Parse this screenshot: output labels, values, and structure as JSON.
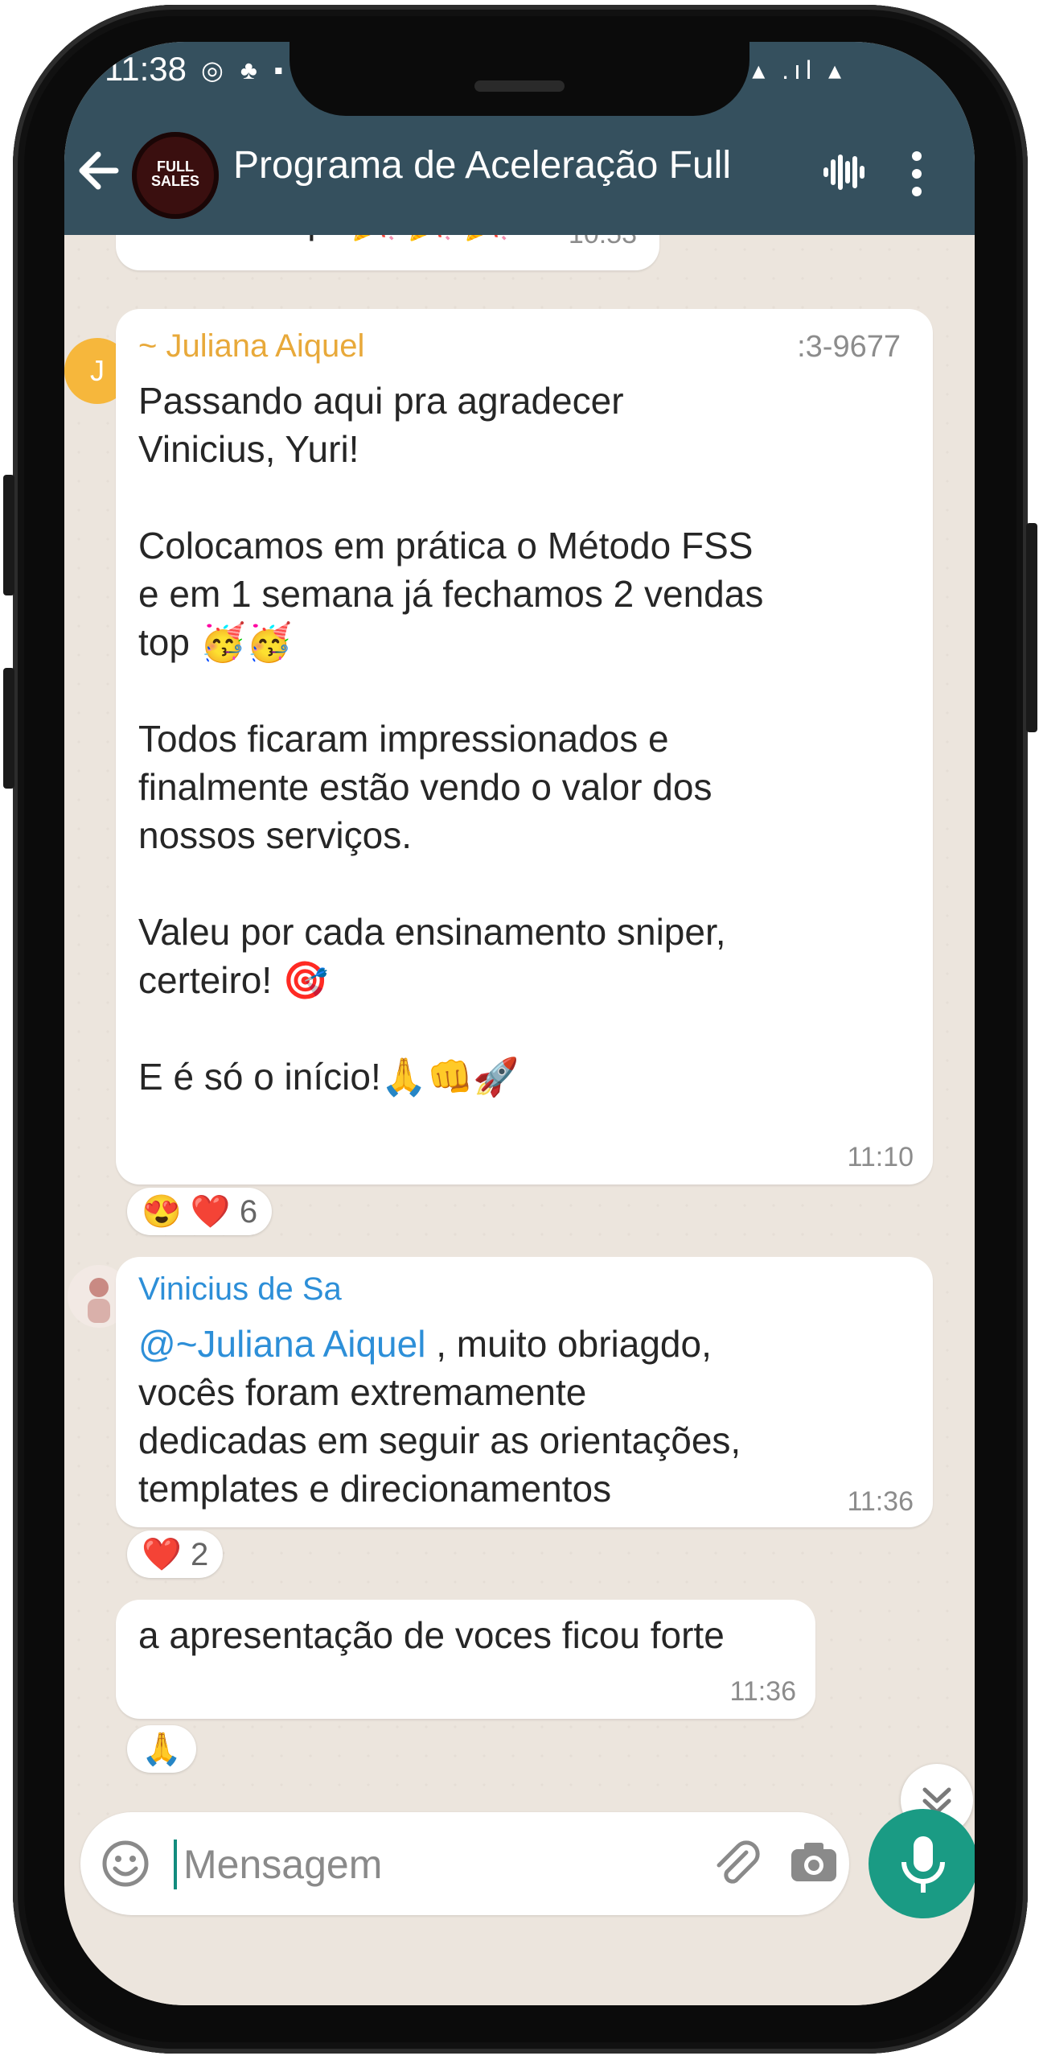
{
  "status_bar": {
    "time": "11:38",
    "icons_left": "◎ ♣ ▪",
    "icons_right": "▴ .ıl ▴"
  },
  "header": {
    "title": "Programa de Aceleração Full...",
    "avatar_logo": "FULL SALES",
    "colors": {
      "bar": "#35505e"
    }
  },
  "messages": {
    "prev": {
      "text": "Bom compr 🎉 🎉 🎉",
      "time": "10:53"
    },
    "juliana": {
      "avatar_initial": "J",
      "sender": "~ Juliana Aiquel",
      "phone": ":3-9677",
      "text": "Passando aqui pra agradecer\nVinicius, Yuri!\n\nColocamos em prática o Método FSS\ne em 1 semana já fechamos 2 vendas\ntop 🥳🥳\n\nTodos ficaram impressionados e\nfinalmente estão vendo o valor dos\nnossos serviços.\n\nValeu por cada ensinamento sniper,\ncerteiro! 🎯\n\nE é só o início!🙏👊🚀",
      "time": "11:10",
      "reactions": "😍 ❤️",
      "reaction_count": "6",
      "sender_color": "#e8a93a"
    },
    "vinicius_1": {
      "sender": "Vinicius de Sa",
      "mention": "@~Juliana Aiquel",
      "text": " , muito obriagdo,\nvocês foram extremamente\ndedicadas em seguir as orientações,\ntemplates e direcionamentos",
      "time": "11:36",
      "reactions": "❤️",
      "reaction_count": "2",
      "sender_color": "#2d8fd8"
    },
    "vinicius_2": {
      "text": "a apresentação de voces ficou forte",
      "time": "11:36",
      "reactions": "🙏"
    }
  },
  "composer": {
    "placeholder": "Mensagem",
    "colors": {
      "send": "#1a9b84"
    }
  }
}
